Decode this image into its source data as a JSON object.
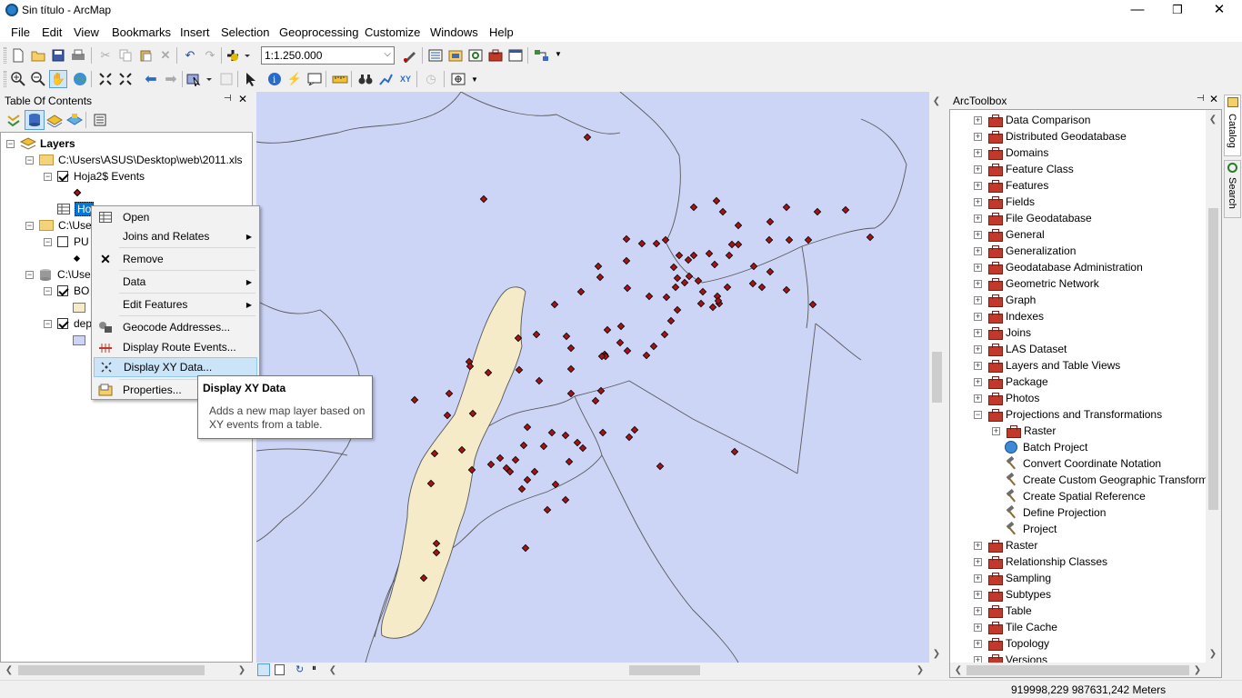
{
  "window": {
    "title": "Sin título - ArcMap",
    "minimize": "—",
    "maximize": "❐",
    "close": "✕"
  },
  "menu": [
    "File",
    "Edit",
    "View",
    "Bookmarks",
    "Insert",
    "Selection",
    "Geoprocessing",
    "Customize",
    "Windows",
    "Help"
  ],
  "toolbar": {
    "scale_value": "1:1.250.000"
  },
  "toc": {
    "title": "Table Of Contents",
    "pin": "📌",
    "close": "✕",
    "layers_label": "Layers",
    "workspace1": "C:\\Users\\ASUS\\Desktop\\web\\2011.xls",
    "events_layer": "Hoja2$ Events",
    "table_label": "Ho",
    "workspace2": "C:\\Use",
    "layer_pu": "PU",
    "workspace3": "C:\\Use",
    "layer_bo": "BO",
    "layer_dep": "dep"
  },
  "context_menu": {
    "items": [
      {
        "label": "Open",
        "icon": "table-icon"
      },
      {
        "label": "Joins and Relates",
        "icon": ""
      },
      {
        "label": "Remove",
        "icon": "remove-x-icon"
      },
      {
        "label": "Data",
        "icon": ""
      },
      {
        "label": "Edit Features",
        "icon": ""
      },
      {
        "label": "Geocode Addresses...",
        "icon": "geocode-icon"
      },
      {
        "label": "Display Route Events...",
        "icon": "route-events-icon"
      },
      {
        "label": "Display XY Data...",
        "icon": "xy-data-icon"
      },
      {
        "label": "Properties...",
        "icon": "properties-icon"
      }
    ],
    "highlighted": "Display XY Data..."
  },
  "tooltip": {
    "title": "Display XY Data",
    "body": "Adds a new map layer based on XY events from a table."
  },
  "arctoolbox": {
    "title": "ArcToolbox",
    "pin": "📌",
    "close": "✕",
    "items": [
      {
        "label": "Data Comparison",
        "kind": "toolbox"
      },
      {
        "label": "Distributed Geodatabase",
        "kind": "toolbox"
      },
      {
        "label": "Domains",
        "kind": "toolbox"
      },
      {
        "label": "Feature Class",
        "kind": "toolbox"
      },
      {
        "label": "Features",
        "kind": "toolbox"
      },
      {
        "label": "Fields",
        "kind": "toolbox"
      },
      {
        "label": "File Geodatabase",
        "kind": "toolbox"
      },
      {
        "label": "General",
        "kind": "toolbox"
      },
      {
        "label": "Generalization",
        "kind": "toolbox"
      },
      {
        "label": "Geodatabase Administration",
        "kind": "toolbox"
      },
      {
        "label": "Geometric Network",
        "kind": "toolbox"
      },
      {
        "label": "Graph",
        "kind": "toolbox"
      },
      {
        "label": "Indexes",
        "kind": "toolbox"
      },
      {
        "label": "Joins",
        "kind": "toolbox"
      },
      {
        "label": "LAS Dataset",
        "kind": "toolbox"
      },
      {
        "label": "Layers and Table Views",
        "kind": "toolbox"
      },
      {
        "label": "Package",
        "kind": "toolbox"
      },
      {
        "label": "Photos",
        "kind": "toolbox"
      },
      {
        "label": "Projections and Transformations",
        "kind": "toolbox-open"
      },
      {
        "label": "Raster",
        "kind": "sub-toolbox"
      },
      {
        "label": "Batch Project",
        "kind": "sub-script"
      },
      {
        "label": "Convert Coordinate Notation",
        "kind": "sub-tool"
      },
      {
        "label": "Create Custom Geographic Transform",
        "kind": "sub-tool"
      },
      {
        "label": "Create Spatial Reference",
        "kind": "sub-tool"
      },
      {
        "label": "Define Projection",
        "kind": "sub-tool"
      },
      {
        "label": "Project",
        "kind": "sub-tool"
      },
      {
        "label": "Raster",
        "kind": "toolbox"
      },
      {
        "label": "Relationship Classes",
        "kind": "toolbox"
      },
      {
        "label": "Sampling",
        "kind": "toolbox"
      },
      {
        "label": "Subtypes",
        "kind": "toolbox"
      },
      {
        "label": "Table",
        "kind": "toolbox"
      },
      {
        "label": "Tile Cache",
        "kind": "toolbox"
      },
      {
        "label": "Topology",
        "kind": "toolbox"
      },
      {
        "label": "Versions",
        "kind": "toolbox"
      }
    ]
  },
  "side_tabs": [
    "Catalog",
    "Search"
  ],
  "status": {
    "coordinates": "919998,229  987631,242 Meters"
  },
  "colors": {
    "map_background": "#cdd5f7",
    "land_fill": "#f5ebc8",
    "point_fill": "#a31515",
    "highlight": "#cce4f7"
  }
}
